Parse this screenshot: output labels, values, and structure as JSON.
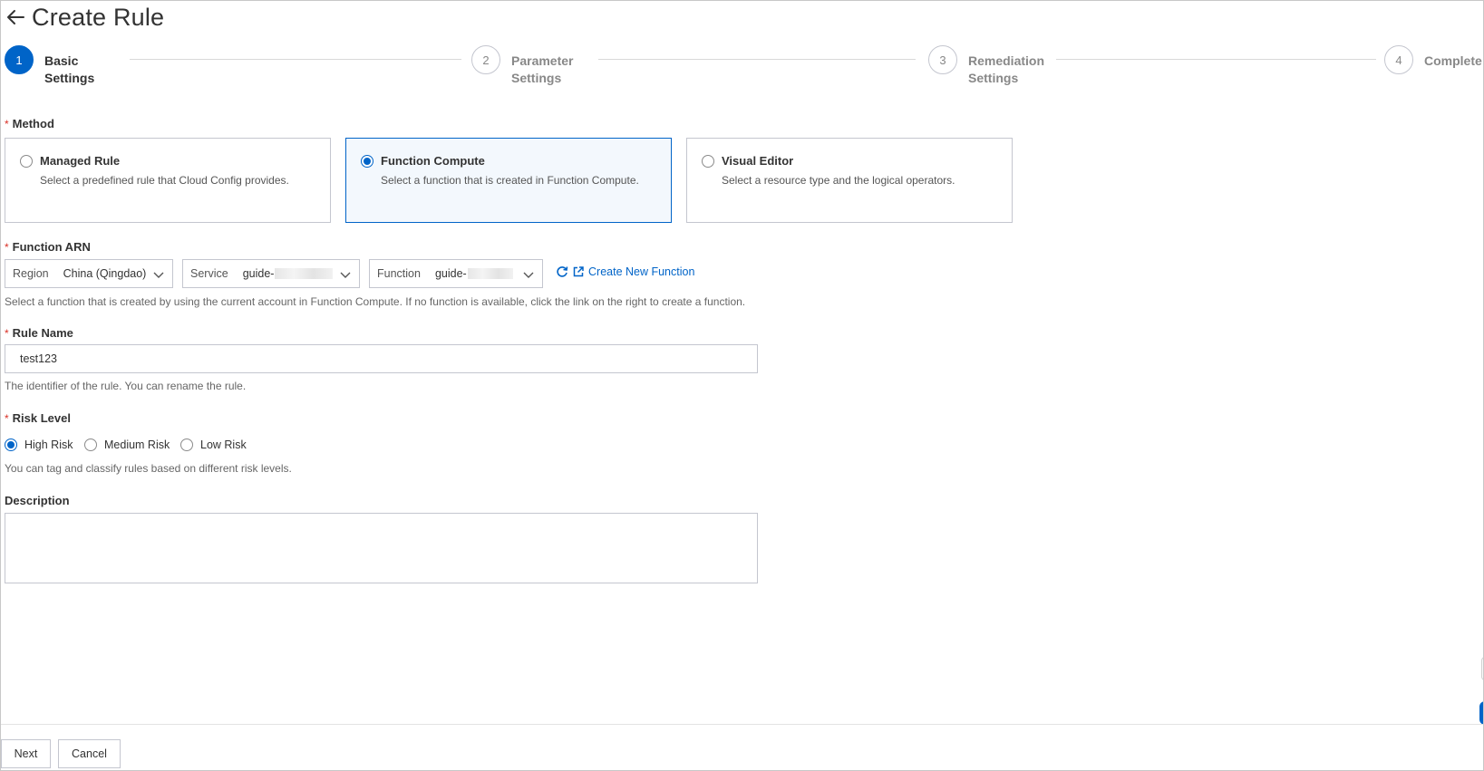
{
  "header": {
    "title": "Create Rule"
  },
  "steps": [
    {
      "number": "1",
      "label": "Basic Settings",
      "active": true
    },
    {
      "number": "2",
      "label": "Parameter Settings",
      "active": false
    },
    {
      "number": "3",
      "label": "Remediation Settings",
      "active": false
    },
    {
      "number": "4",
      "label": "Complete",
      "active": false
    }
  ],
  "method": {
    "label": "Method",
    "options": [
      {
        "title": "Managed Rule",
        "desc": "Select a predefined rule that Cloud Config provides.",
        "selected": false
      },
      {
        "title": "Function Compute",
        "desc": "Select a function that is created in Function Compute.",
        "selected": true
      },
      {
        "title": "Visual Editor",
        "desc": "Select a resource type and the logical operators.",
        "selected": false
      }
    ]
  },
  "function_arn": {
    "label": "Function ARN",
    "region": {
      "label": "Region",
      "value": "China (Qingdao)"
    },
    "service": {
      "label": "Service",
      "value": "guide-"
    },
    "function": {
      "label": "Function",
      "value": "guide-"
    },
    "create_link": "Create New Function",
    "help": "Select a function that is created by using the current account in Function Compute. If no function is available, click the link on the right to create a function."
  },
  "rule_name": {
    "label": "Rule Name",
    "value": "test123",
    "help": "The identifier of the rule. You can rename the rule."
  },
  "risk_level": {
    "label": "Risk Level",
    "options": [
      {
        "label": "High Risk",
        "checked": true
      },
      {
        "label": "Medium Risk",
        "checked": false
      },
      {
        "label": "Low Risk",
        "checked": false
      }
    ],
    "help": "You can tag and classify rules based on different risk levels."
  },
  "description": {
    "label": "Description",
    "value": ""
  },
  "footer": {
    "next_label": "Next",
    "cancel_label": "Cancel"
  },
  "colors": {
    "accent": "#0064c8",
    "required": "#d93026",
    "border": "#c4c6cf"
  }
}
